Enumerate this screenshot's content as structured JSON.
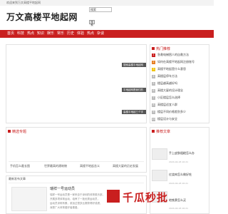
{
  "topbar": {
    "text": "欢迎来到万文高楼平地起网"
  },
  "header": {
    "logo": "万文高楼平地起网",
    "search_value": "搜索",
    "search_button": "搜索"
  },
  "nav": {
    "items": [
      "首页",
      "科技",
      "热点",
      "知识",
      "娱乐",
      "常乐",
      "历史",
      "体验",
      "热点",
      "杂谈"
    ],
    "accent": "#c91f1f"
  },
  "slider": {
    "captions": [
      "搜索高楼平地起网",
      "平地起网是我们的",
      "高楼平地起三个字"
    ]
  },
  "hot": {
    "title": "热门推荐",
    "items": [
      "急救电梯困人的自救方法",
      "如何在高楼平地起网注册账号",
      "高楼平地起是什么意思",
      "高楼层停车方法",
      "楼层越高越好吗",
      "高楼大厦的设计理念",
      "小区楼层怎么选择",
      "高楼层适宜人群",
      "楼层不同价格差别多少",
      "楼层设计与安全"
    ]
  },
  "tags": {
    "title": "精选专题",
    "cells": [
      "手机怎么截长图",
      "世界最高的建筑物",
      "高楼平地起含义",
      "高楼大厦的历史发展"
    ]
  },
  "recommend": {
    "title": "推荐文章",
    "items": [
      {
        "title": "手上皮肤粗糙怎么办",
        "meta": "2024-04-18  16:21"
      },
      {
        "title": "红烧肉怎么做好吃",
        "meta": "2024-04-18  16:21"
      },
      {
        "title": "地铁票怎么买",
        "meta": "2024-04-18  16:21"
      }
    ]
  },
  "article": {
    "heading": "最新发布文章",
    "title": "瑞祥一号运动员",
    "lines": [
      "瑞祥一号运动员是一家来自于深圳的体育俱乐部，",
      "开展多项体育运动，培养了一批优秀运动员，",
      "运动员训练有素，参加过很多比赛获得好成绩，",
      "深受广大体育爱好者喜爱。"
    ]
  },
  "watermark": {
    "text": "千瓜秒批",
    "accent": "#c91f1f"
  }
}
